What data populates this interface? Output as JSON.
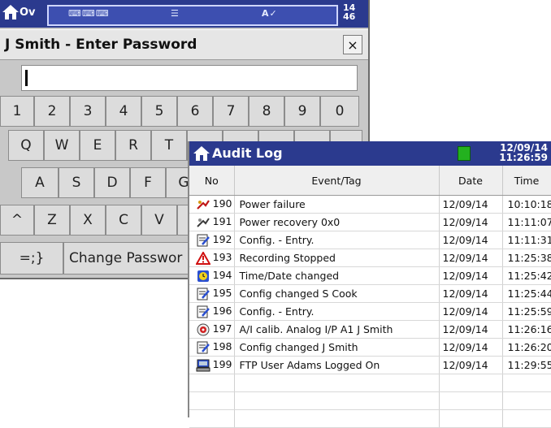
{
  "topbar": {
    "ov_text": "Ov",
    "clock_line1": "14",
    "clock_line2": "46"
  },
  "password_dialog": {
    "title": "J Smith - Enter Password",
    "close_label": "×",
    "input_value": ""
  },
  "keyboard": {
    "row1": [
      "1",
      "2",
      "3",
      "4",
      "5",
      "6",
      "7",
      "8",
      "9",
      "0"
    ],
    "row2": [
      "Q",
      "W",
      "E",
      "R",
      "T"
    ],
    "row3": [
      "A",
      "S",
      "D",
      "F",
      "G"
    ],
    "row4": [
      "^",
      "Z",
      "X",
      "C",
      "V"
    ],
    "row5_symbol": "=;}",
    "change_password": "Change Passwor"
  },
  "audit_log": {
    "title": "Audit Log",
    "date": "12/09/14",
    "time": "11:26:59",
    "columns": {
      "no": "No",
      "event": "Event/Tag",
      "date": "Date",
      "time": "Time"
    },
    "rows": [
      {
        "icon": "power-failure-icon",
        "no": "190",
        "event": "Power failure",
        "date": "12/09/14",
        "time": "10:10:18"
      },
      {
        "icon": "power-recovery-icon",
        "no": "191",
        "event": "Power recovery   0x0",
        "date": "12/09/14",
        "time": "11:11:07"
      },
      {
        "icon": "config-icon",
        "no": "192",
        "event": "Config. - Entry.",
        "date": "12/09/14",
        "time": "11:11:31"
      },
      {
        "icon": "warning-icon",
        "no": "193",
        "event": "Recording Stopped",
        "date": "12/09/14",
        "time": "11:25:38"
      },
      {
        "icon": "clock-icon",
        "no": "194",
        "event": "Time/Date changed",
        "date": "12/09/14",
        "time": "11:25:42"
      },
      {
        "icon": "config-icon",
        "no": "195",
        "event": "Config changed  S Cook",
        "date": "12/09/14",
        "time": "11:25:44"
      },
      {
        "icon": "config-icon",
        "no": "196",
        "event": "Config. - Entry.",
        "date": "12/09/14",
        "time": "11:25:59"
      },
      {
        "icon": "calibration-icon",
        "no": "197",
        "event": "A/I calib.  Analog I/P A1  J Smith",
        "date": "12/09/14",
        "time": "11:26:16"
      },
      {
        "icon": "config-icon",
        "no": "198",
        "event": "Config changed  J Smith",
        "date": "12/09/14",
        "time": "11:26:20"
      },
      {
        "icon": "computer-icon",
        "no": "199",
        "event": "FTP User Adams Logged On",
        "date": "12/09/14",
        "time": "11:29:55"
      }
    ]
  }
}
